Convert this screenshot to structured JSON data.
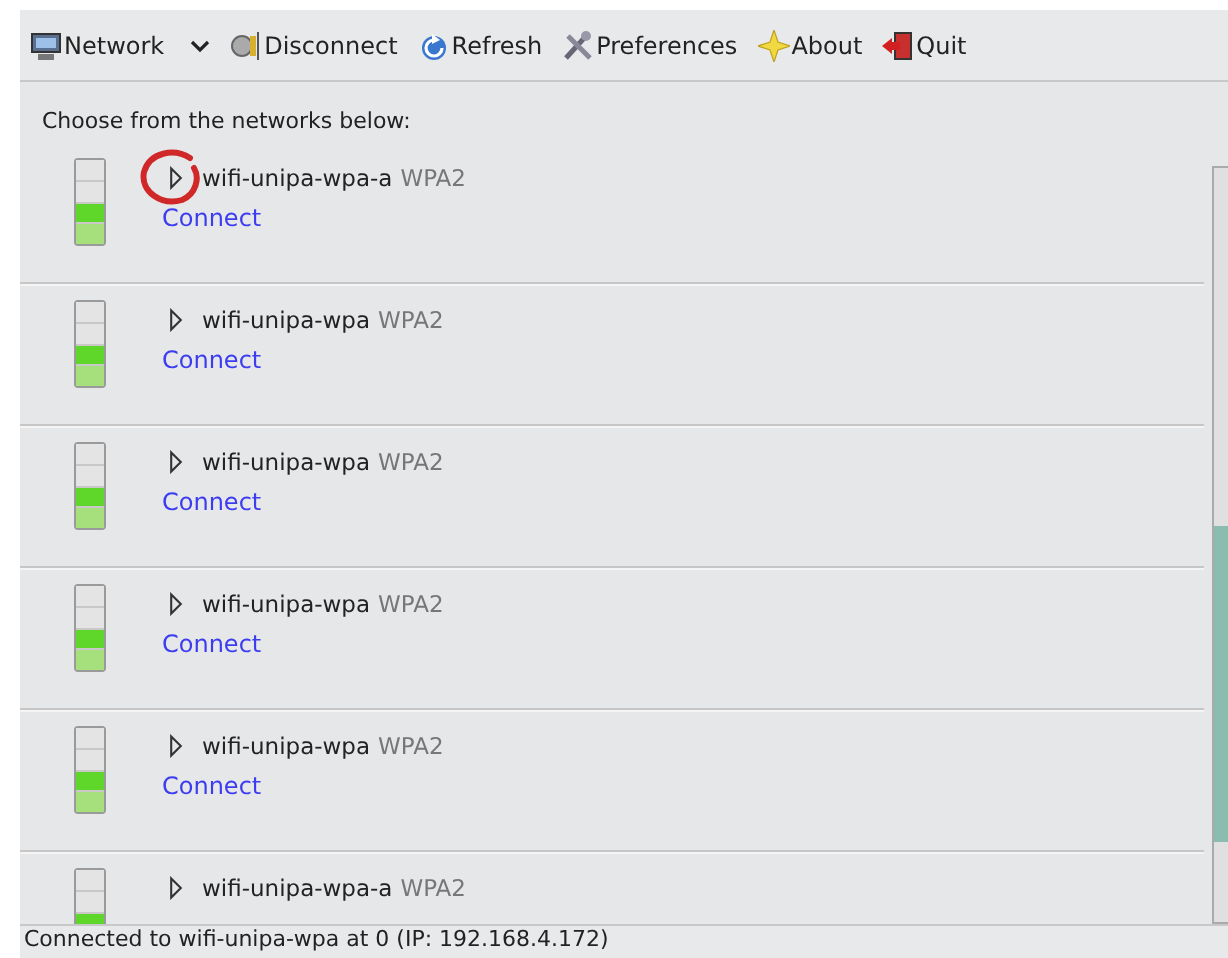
{
  "toolbar": [
    {
      "kind": "network",
      "label": "Network",
      "has_menu": true
    },
    {
      "kind": "disconnect",
      "label": "Disconnect",
      "has_menu": false
    },
    {
      "kind": "refresh",
      "label": "Refresh",
      "has_menu": false
    },
    {
      "kind": "preferences",
      "label": "Preferences",
      "has_menu": false
    },
    {
      "kind": "about",
      "label": "About",
      "has_menu": false
    },
    {
      "kind": "quit",
      "label": "Quit",
      "has_menu": false
    }
  ],
  "prompt": "Choose from the networks below:",
  "networks": [
    {
      "name": "wifi-unipa-wpa-a",
      "security": "WPA2",
      "level": 0.5,
      "action": "Connect",
      "circled": true
    },
    {
      "name": "wifi-unipa-wpa",
      "security": "WPA2",
      "level": 0.5,
      "action": "Connect",
      "circled": false
    },
    {
      "name": "wifi-unipa-wpa",
      "security": "WPA2",
      "level": 0.5,
      "action": "Connect",
      "circled": false
    },
    {
      "name": "wifi-unipa-wpa",
      "security": "WPA2",
      "level": 0.5,
      "action": "Connect",
      "circled": false
    },
    {
      "name": "wifi-unipa-wpa",
      "security": "WPA2",
      "level": 0.5,
      "action": "Connect",
      "circled": false
    },
    {
      "name": "wifi-unipa-wpa-a",
      "security": "WPA2",
      "level": 0.5,
      "circled": false
    }
  ],
  "status_bar": "Connected to wifi-unipa-wpa at 0 (IP: 192.168.4.172)"
}
